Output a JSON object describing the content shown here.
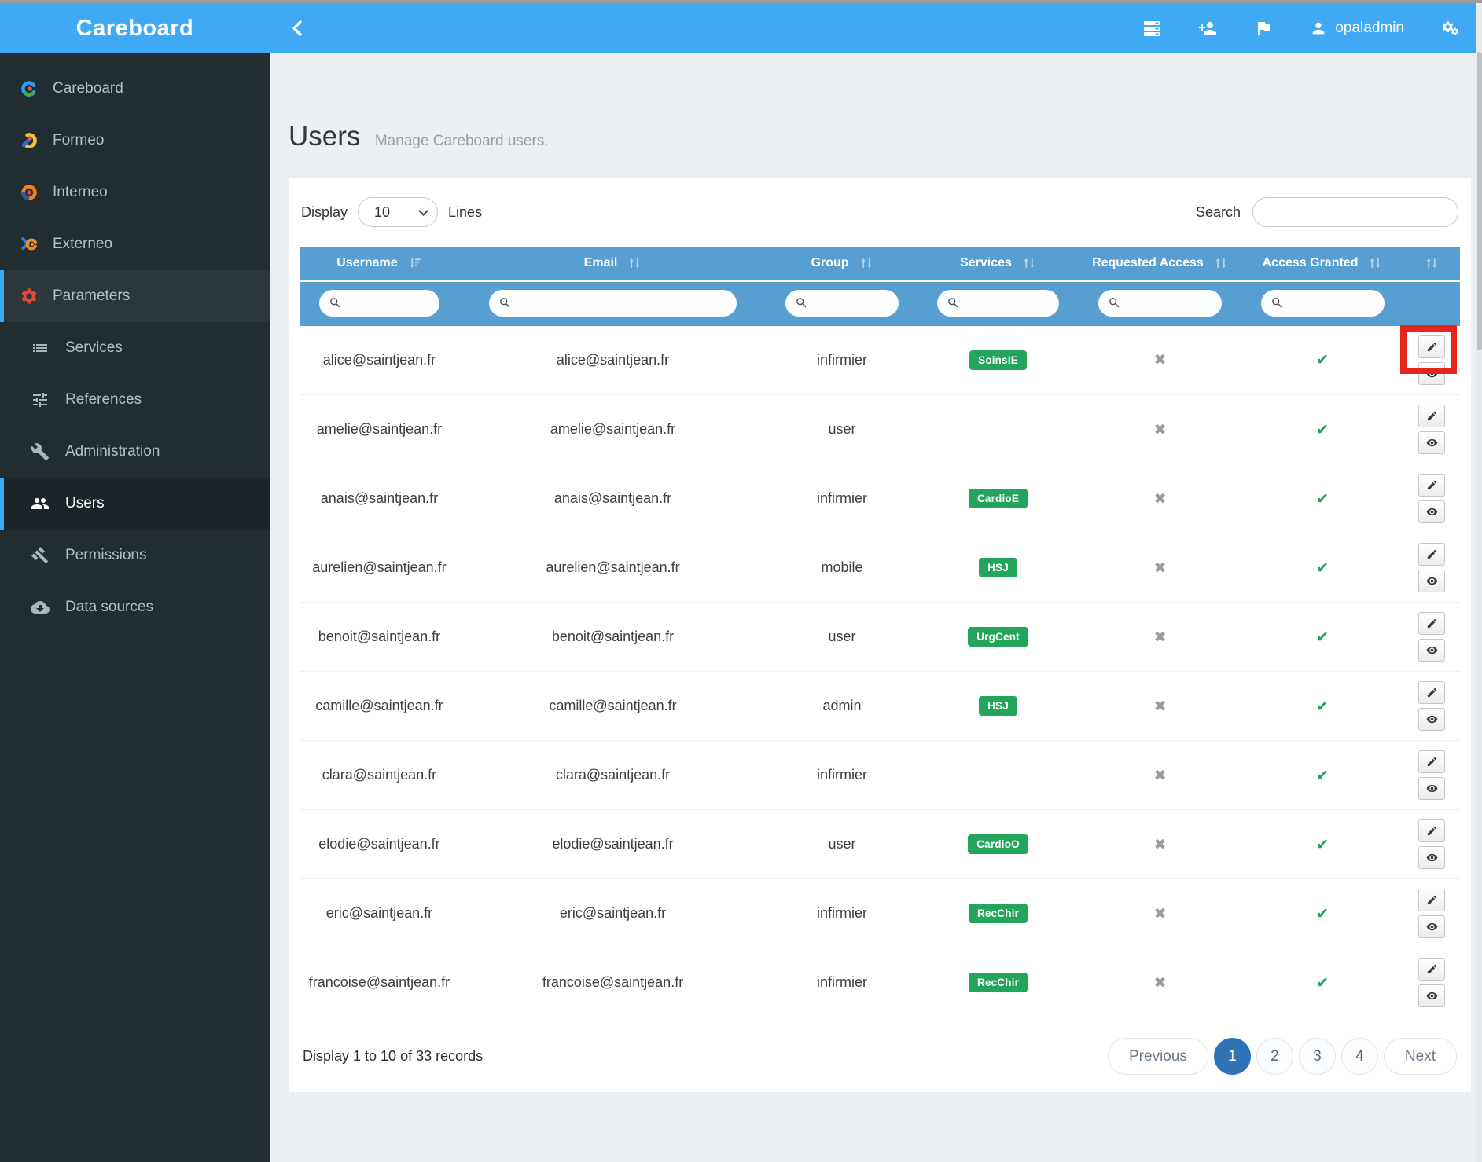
{
  "brand": {
    "title": "Careboard"
  },
  "topbar": {
    "username": "opaladmin"
  },
  "sidebar": {
    "items": [
      {
        "label": "Careboard"
      },
      {
        "label": "Formeo"
      },
      {
        "label": "Interneo"
      },
      {
        "label": "Externeo"
      },
      {
        "label": "Parameters"
      },
      {
        "label": "Services"
      },
      {
        "label": "References"
      },
      {
        "label": "Administration"
      },
      {
        "label": "Users"
      },
      {
        "label": "Permissions"
      },
      {
        "label": "Data sources"
      }
    ]
  },
  "page": {
    "title": "Users",
    "subtitle": "Manage Careboard users."
  },
  "toolbar": {
    "display_label": "Display",
    "page_size": "10",
    "lines_label": "Lines",
    "search_label": "Search",
    "search_value": ""
  },
  "table": {
    "columns": [
      "Username",
      "Email",
      "Group",
      "Services",
      "Requested Access",
      "Access Granted",
      ""
    ],
    "marks": {
      "yes": "✔",
      "no": "✖"
    },
    "rows": [
      {
        "username": "alice@saintjean.fr",
        "email": "alice@saintjean.fr",
        "group": "infirmier",
        "service": "SoinsIE",
        "requested_access": false,
        "access_granted": true
      },
      {
        "username": "amelie@saintjean.fr",
        "email": "amelie@saintjean.fr",
        "group": "user",
        "service": "",
        "requested_access": false,
        "access_granted": true
      },
      {
        "username": "anais@saintjean.fr",
        "email": "anais@saintjean.fr",
        "group": "infirmier",
        "service": "CardioE",
        "requested_access": false,
        "access_granted": true
      },
      {
        "username": "aurelien@saintjean.fr",
        "email": "aurelien@saintjean.fr",
        "group": "mobile",
        "service": "HSJ",
        "requested_access": false,
        "access_granted": true
      },
      {
        "username": "benoit@saintjean.fr",
        "email": "benoit@saintjean.fr",
        "group": "user",
        "service": "UrgCent",
        "requested_access": false,
        "access_granted": true
      },
      {
        "username": "camille@saintjean.fr",
        "email": "camille@saintjean.fr",
        "group": "admin",
        "service": "HSJ",
        "requested_access": false,
        "access_granted": true
      },
      {
        "username": "clara@saintjean.fr",
        "email": "clara@saintjean.fr",
        "group": "infirmier",
        "service": "",
        "requested_access": false,
        "access_granted": true
      },
      {
        "username": "elodie@saintjean.fr",
        "email": "elodie@saintjean.fr",
        "group": "user",
        "service": "CardioO",
        "requested_access": false,
        "access_granted": true
      },
      {
        "username": "eric@saintjean.fr",
        "email": "eric@saintjean.fr",
        "group": "infirmier",
        "service": "RecChir",
        "requested_access": false,
        "access_granted": true
      },
      {
        "username": "francoise@saintjean.fr",
        "email": "francoise@saintjean.fr",
        "group": "infirmier",
        "service": "RecChir",
        "requested_access": false,
        "access_granted": true
      }
    ]
  },
  "footer": {
    "summary": "Display 1 to 10 of 33 records",
    "previous_label": "Previous",
    "pages": [
      "1",
      "2",
      "3",
      "4"
    ],
    "active_page": "1",
    "next_label": "Next"
  },
  "colors": {
    "topbar_blue": "#3fa9f4",
    "sidebar_dark": "#222d32",
    "table_header_blue": "#579fd0",
    "badge_green": "#23a55c",
    "check_green": "#1fa35a",
    "cross_gray": "#9a9a9a",
    "active_page_blue": "#2e74b5",
    "annotation_red": "#e6261c"
  }
}
